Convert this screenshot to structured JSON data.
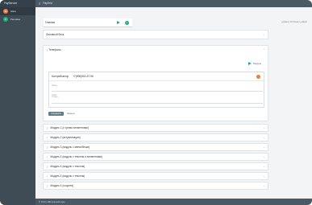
{
  "app": {
    "brand": "PayService",
    "topbar_title": "PayTest",
    "footer": "© ООО «Витальный код»"
  },
  "sidebar": {
    "items": [
      {
        "label": "Шаги",
        "color": "#f07b3a",
        "letter": "Ш"
      },
      {
        "label": "Реклама",
        "color": "#21b07d",
        "letter": "Р"
      }
    ]
  },
  "main": {
    "select_value": "Главная",
    "top_right": "● Шаги | 10 блоки | ● Шаги",
    "section_select": "Основной блок",
    "phones": {
      "title": "Телефоны",
      "tag": "Модуль",
      "inner_label": "Контрибьютор",
      "inner_number": "+7(906)552-67-96",
      "field1": "Город",
      "field2": "Адрес",
      "field2_hint": "Телефон",
      "save": "Сохранить",
      "cancel": "Закрыть"
    },
    "modules": [
      "Модуль 1 (с трема элементами)",
      "Модуль 2 (актуализация)",
      "Модуль 3 (модуль с меню/блоки)",
      "Модуль 4 (модуль с текстом и элементами)",
      "Модуль 4 (модуль с текстом)",
      "Модуль 4 (модуль с текстом)",
      "Модуль 4 (соцсети)"
    ]
  }
}
